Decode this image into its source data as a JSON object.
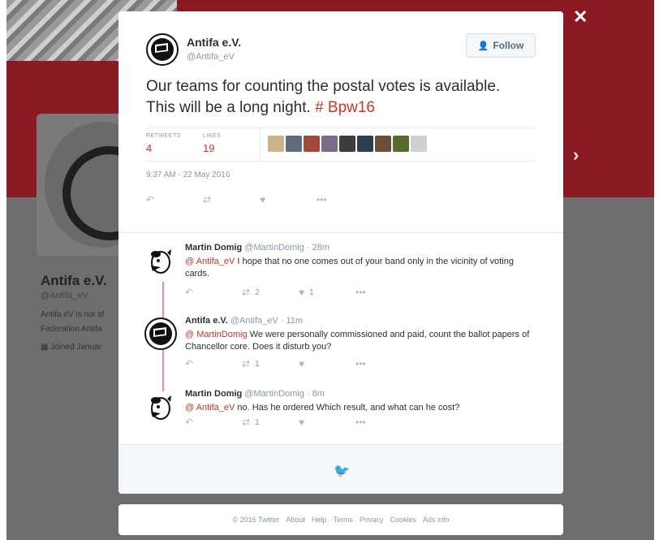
{
  "background": {
    "profile_name": "Antifa e.V.",
    "profile_handle": "@Antifa_eV",
    "bio_line_1": "Antifa eV is not af",
    "bio_line_2": "Federation Antifa",
    "joined": "Joined Januar"
  },
  "overlay": {
    "close_glyph": "✕",
    "next_glyph": "›"
  },
  "tweet": {
    "author_name": "Antifa e.V.",
    "author_handle": "@Antifa_eV",
    "follow_label": "Follow",
    "text": "Our teams for counting the postal votes is available. This will be a long night. ",
    "hashtag": "# Bpw16",
    "retweets_label": "RETWEETS",
    "retweets": "4",
    "likes_label": "LIKES",
    "likes": "19",
    "date": "9:37 AM - 22 May 2016",
    "liker_colors": [
      "#c9b48a",
      "#5d6d7e",
      "#a04a3c",
      "#7d6b8a",
      "#3d3d3d",
      "#2c3e50",
      "#6b4f3a",
      "#556b2f",
      "#d0d0d0"
    ]
  },
  "replies": [
    {
      "name": "Martin Domig",
      "handle": "@MartinDomig · 28m",
      "mention": "@ Antifa_eV",
      "text": " I hope that no one comes out of your band only in the vicinity of voting cards.",
      "retweets": "2",
      "likes": "1"
    },
    {
      "name": "Antifa e.V.",
      "handle": "@Antifa_eV · 11m",
      "mention": "@ MartinDomig",
      "text": " We were personally commissioned and paid, count the ballot papers of Chancellor core. Does it disturb you?",
      "retweets": "1",
      "likes": ""
    },
    {
      "name": "Martin Domig",
      "handle": "@MartinDomig · 8m",
      "mention": "@ Antifa_eV",
      "text": " no. Has he ordered Which result, and what can he cost?",
      "retweets": "1",
      "likes": ""
    }
  ],
  "footer": {
    "copyright": "© 2016 Twitter",
    "about": "About",
    "help": "Help",
    "terms": "Terms",
    "privacy": "Privacy",
    "cookies": "Cookies",
    "ads_info": "Ads info"
  },
  "colors": {
    "accent": "#c0392b",
    "banner": "#8b1a25",
    "link_blue": "#2b7bb9"
  }
}
